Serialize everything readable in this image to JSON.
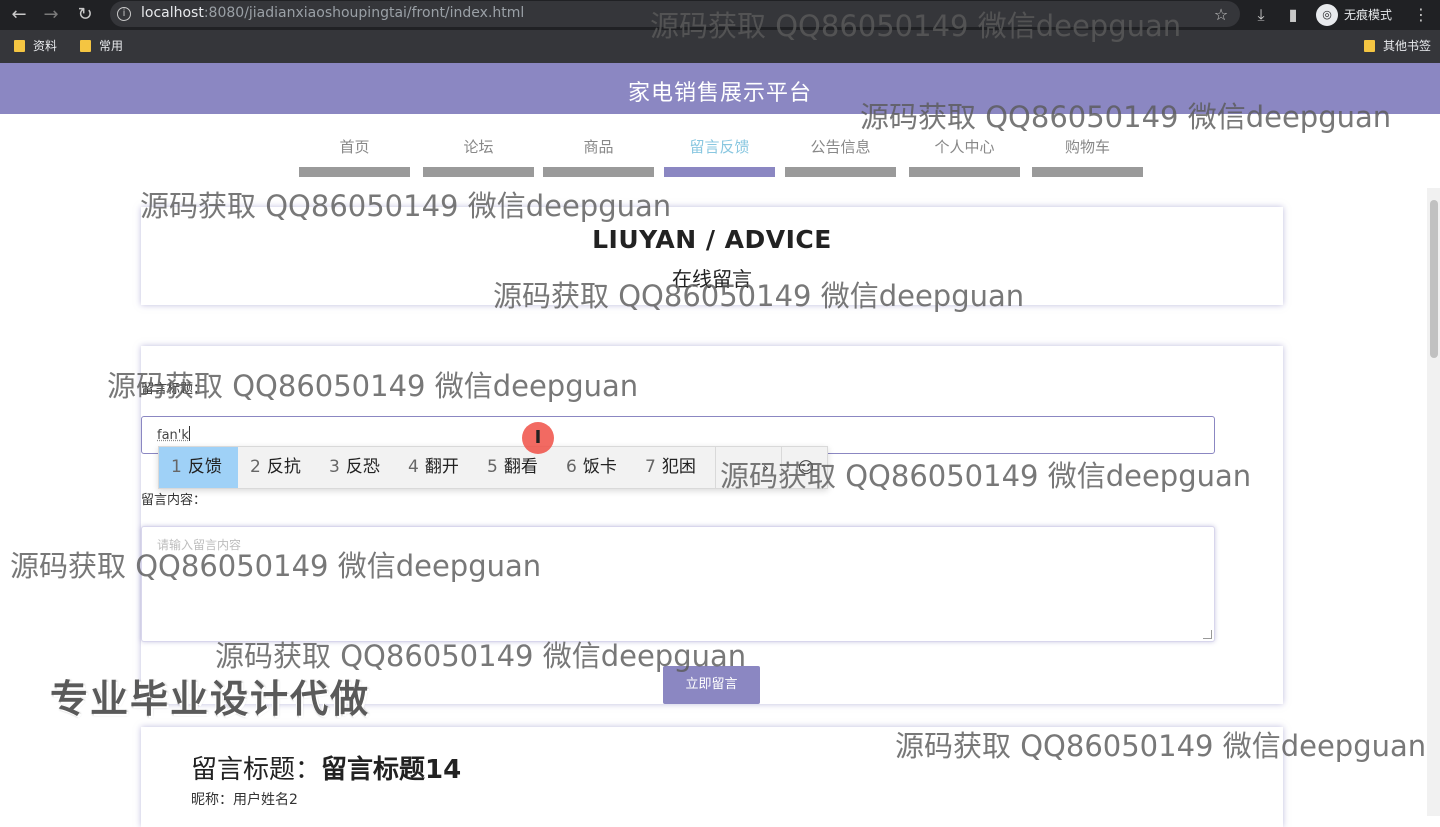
{
  "browser": {
    "url_host": "localhost",
    "url_path": ":8080/jiadianxiaoshoupingtai/front/index.html",
    "incognito_label": "无痕模式",
    "bookmarks": [
      "资料",
      "常用"
    ],
    "other_bookmarks": "其他书签",
    "icons": {
      "back": "←",
      "forward": "→",
      "reload": "↻",
      "info": "i",
      "star": "☆",
      "download": "⤓",
      "sidebar": "▮",
      "incognito": "◎",
      "menu": "⋮"
    }
  },
  "site": {
    "title": "家电销售展示平台",
    "accent_color": "#8b87c2",
    "active_nav_color": "#89c7e0"
  },
  "nav": {
    "items": [
      {
        "label": "首页"
      },
      {
        "label": "论坛"
      },
      {
        "label": "商品"
      },
      {
        "label": "留言反馈",
        "active": true
      },
      {
        "label": "公告信息"
      },
      {
        "label": "个人中心"
      },
      {
        "label": "购物车"
      }
    ]
  },
  "header_panel": {
    "heading": "LIUYAN / ADVICE",
    "subheading": "在线留言"
  },
  "form": {
    "title_label": "留言标题：",
    "title_value": "fan'k",
    "content_label": "留言内容：",
    "content_placeholder": "请输入留言内容",
    "submit_label": "立即留言"
  },
  "ime": {
    "candidates": [
      {
        "num": "1",
        "text": "反馈"
      },
      {
        "num": "2",
        "text": "反抗"
      },
      {
        "num": "3",
        "text": "反恐"
      },
      {
        "num": "4",
        "text": "翻开"
      },
      {
        "num": "5",
        "text": "翻看"
      },
      {
        "num": "6",
        "text": "饭卡"
      },
      {
        "num": "7",
        "text": "犯困"
      }
    ],
    "next_page": "›",
    "emoji": "☺"
  },
  "cursor_glyph": "I",
  "message": {
    "title_prefix": "留言标题：",
    "title_value": "留言标题14",
    "nickname": "昵称：用户姓名2"
  },
  "watermarks": {
    "text": "源码获取 QQ86050149 微信deepguan",
    "promo": "专业毕业设计代做"
  }
}
